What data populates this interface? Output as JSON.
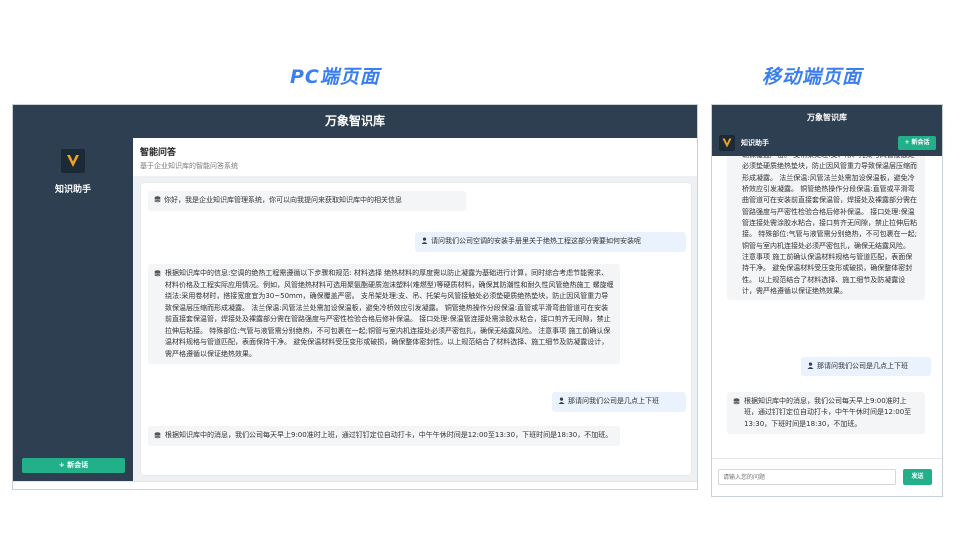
{
  "captions": {
    "pc": "PC端页面",
    "mobile": "移动端页面"
  },
  "app": {
    "title": "万象智识库",
    "brand": "知识助手",
    "new_chat": "+ 新会话"
  },
  "pc": {
    "header_title": "智能问答",
    "header_subtitle": "基于企业知识库的智能问答系统",
    "messages": [
      {
        "role": "bot",
        "text": "你好，我是企业知识库管理系统，你可以向我提问来获取知识库中的相关信息"
      },
      {
        "role": "user",
        "text": "请问我们公司空调的安装手册里关于绝热工程这部分需要如何安装呢"
      },
      {
        "role": "bot",
        "text": "根据知识库中的信息:空调的绝热工程需遵循以下步骤和规范: 材料选择 绝热材料的厚度需以防止凝露为基础进行计算，同时综合考虑节能需求、材料价格及工程实际应用情况。例如，风管绝热材料可选用聚氨酯硬质泡沫塑料(难燃型)等硬质材料，确保其防潮性和耐久性风管绝热施工 螺旋缠绕法:采用卷材时，搭接宽度宜为30~50mm，确保覆盖严密。 支吊架处理:支、吊、托架与风管接触处必须垫硬质绝热垫块，防止因风管重力导致保温层压缩而形成凝露。 法兰保温:风管法兰处需加设保温板，避免冷桥效应引发凝露。 铜管绝热操作分段保温:直管或平滑弯曲管道可在安装前直接套保温管，焊接处及裸露部分需在管路强度与严密性检验合格后修补保温。 接口处理:保温管连接处需涂胶水粘合，接口剪齐无间隙，禁止拉伸后粘接。 特殊部位:气管与液管需分别绝热，不可包裹在一起;铜管与室内机连接处必须严密包扎，确保无结露风险。 注意事项 施工前确认保温材料规格与管道匹配，表面保持干净。 避免保温材料受压变形或破损，确保整体密封性。以上规范结合了材料选择、施工细节及防凝露设计，需严格遵循以保证绝热效果。"
      },
      {
        "role": "user",
        "text": "那请问我们公司是几点上下班"
      },
      {
        "role": "bot",
        "text": "根据知识库中的消息，我们公司每天早上9:00准时上班，通过钉钉定位自动打卡，中午午休时间是12:00至13:30，下班时间是18:30，不加班。"
      }
    ]
  },
  "mobile": {
    "messages": [
      {
        "role": "bot",
        "text": "确保覆盖严密。 支吊架处理:支、吊、托架与风管接触处必须垫硬质绝热垫块，防止因风管重力导致保温层压缩而形成凝露。 法兰保温:风管法兰处需加设保温板，避免冷桥效应引发凝露。 铜管绝热操作分段保温:直管或平滑弯曲管道可在安装前直接套保温管，焊接处及裸露部分需在管路强度与严密性检验合格后修补保温。 接口处理:保温管连接处需涂胶水粘合，接口剪齐无间隙，禁止拉伸后粘接。 特殊部位:气管与液管需分别绝热，不可包裹在一起;铜管与室内机连接处必须严密包扎，确保无结露风险。 注意事项 施工前确认保温材料规格与管道匹配，表面保持干净。 避免保温材料受压变形或破损，确保整体密封性。 以上规范结合了材料选择、施工细节及防凝露设计，需严格遵循以保证绝热效果。"
      },
      {
        "role": "user",
        "text": "那请问我们公司是几点上下班"
      },
      {
        "role": "bot",
        "text": "根据知识库中的消息，我们公司每天早上9:00准时上班，通过钉钉定位自动打卡，中午午休时间是12:00至13:30，下班时间是18:30，不加班。"
      }
    ],
    "input_placeholder": "请输入您的问题",
    "send_label": "发送"
  },
  "icons": {
    "bot": "database-icon",
    "user": "user-icon",
    "logo": "v-logo-icon"
  },
  "colors": {
    "primary": "#2e3f51",
    "accent": "#22b08a",
    "caption": "#3a7ff0",
    "user_bubble": "#e9f2fd",
    "bot_bubble": "#f4f5f7",
    "logo_v": "#f0a21e"
  }
}
